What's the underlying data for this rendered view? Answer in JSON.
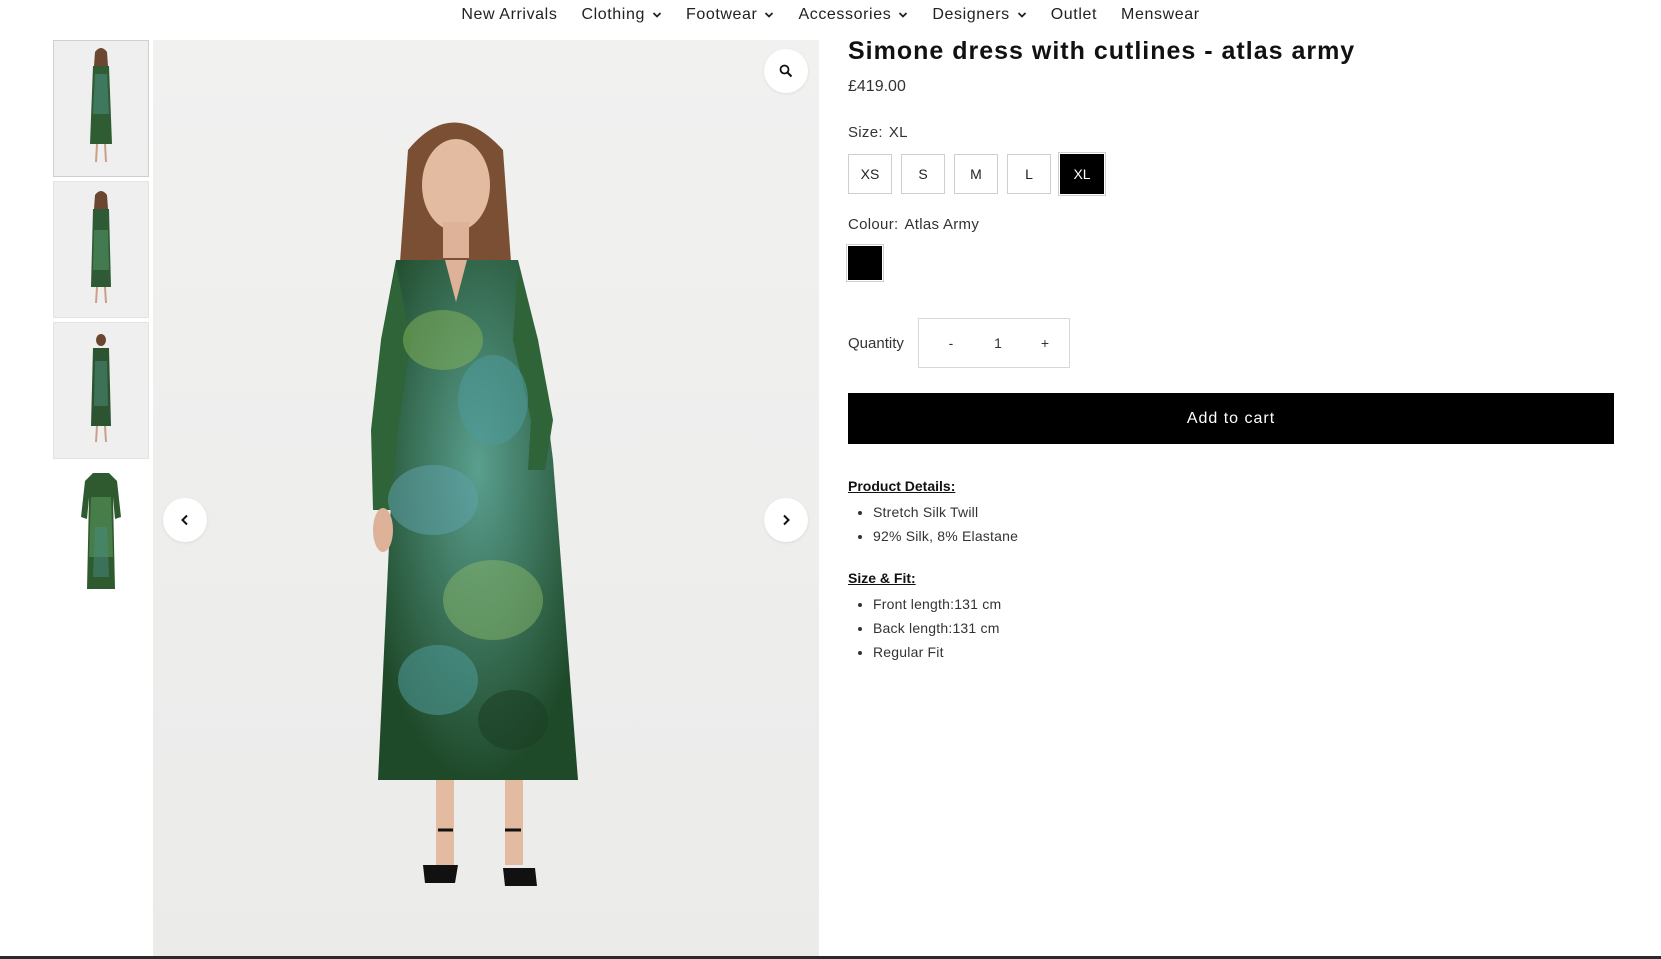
{
  "nav": {
    "items": [
      {
        "label": "New Arrivals",
        "has_dropdown": false
      },
      {
        "label": "Clothing",
        "has_dropdown": true
      },
      {
        "label": "Footwear",
        "has_dropdown": true
      },
      {
        "label": "Accessories",
        "has_dropdown": true
      },
      {
        "label": "Designers",
        "has_dropdown": true
      },
      {
        "label": "Outlet",
        "has_dropdown": false
      },
      {
        "label": "Menswear",
        "has_dropdown": false
      }
    ]
  },
  "gallery": {
    "thumbnail_count": 4,
    "icons": {
      "zoom": "magnifier-icon",
      "prev": "chevron-left-icon",
      "next": "chevron-right-icon"
    }
  },
  "product": {
    "title": "Simone dress with cutlines - atlas army",
    "price": "£419.00",
    "size": {
      "label": "Size:",
      "selected": "XL",
      "options": [
        "XS",
        "S",
        "M",
        "L",
        "XL"
      ]
    },
    "colour": {
      "label": "Colour:",
      "selected": "Atlas Army",
      "swatch_color": "#000000"
    },
    "quantity": {
      "label": "Quantity",
      "decrement": "-",
      "value": "1",
      "increment": "+"
    },
    "add_to_cart": "Add to cart",
    "details": {
      "heading": "Product Details:",
      "items": [
        "Stretch Silk Twill",
        "92% Silk, 8% Elastane"
      ]
    },
    "size_fit": {
      "heading": "Size & Fit:",
      "items": [
        "Front length:131 cm",
        "Back length:131 cm",
        "Regular Fit"
      ]
    }
  },
  "colors": {
    "button_bg": "#000000",
    "dress_dark": "#1f4a2a",
    "dress_teal": "#4f9a9a",
    "dress_light": "#7fae5a"
  }
}
